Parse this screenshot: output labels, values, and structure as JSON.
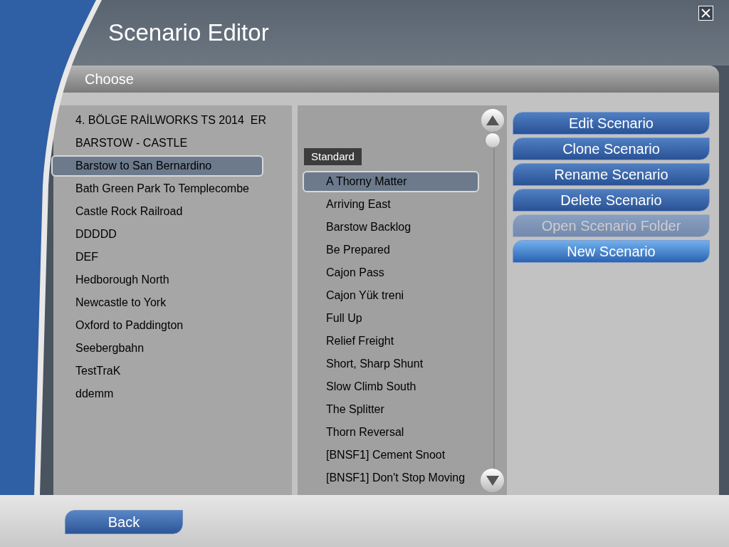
{
  "window": {
    "title": "Scenario Editor"
  },
  "section": {
    "title": "Choose"
  },
  "routes": [
    {
      "label": "4. BÖLGE RAİLWORKS TS 2014  ER",
      "selected": false
    },
    {
      "label": "BARSTOW - CASTLE",
      "selected": false
    },
    {
      "label": "Barstow to San Bernardino",
      "selected": true
    },
    {
      "label": "Bath Green Park To Templecombe",
      "selected": false
    },
    {
      "label": "Castle Rock Railroad",
      "selected": false
    },
    {
      "label": "DDDDD",
      "selected": false
    },
    {
      "label": "DEF",
      "selected": false
    },
    {
      "label": "Hedborough North",
      "selected": false
    },
    {
      "label": "Newcastle to York",
      "selected": false
    },
    {
      "label": "Oxford to Paddington",
      "selected": false
    },
    {
      "label": "Seebergbahn",
      "selected": false
    },
    {
      "label": "TestTraK",
      "selected": false
    },
    {
      "label": "ddemm",
      "selected": false
    }
  ],
  "scenarios": {
    "group": "Standard",
    "items": [
      {
        "label": "A Thorny Matter",
        "selected": true
      },
      {
        "label": "Arriving East",
        "selected": false
      },
      {
        "label": "Barstow Backlog",
        "selected": false
      },
      {
        "label": "Be Prepared",
        "selected": false
      },
      {
        "label": "Cajon Pass",
        "selected": false
      },
      {
        "label": "Cajon Yük treni",
        "selected": false
      },
      {
        "label": "Full Up",
        "selected": false
      },
      {
        "label": "Relief Freight",
        "selected": false
      },
      {
        "label": "Short, Sharp Shunt",
        "selected": false
      },
      {
        "label": "Slow Climb South",
        "selected": false
      },
      {
        "label": "The Splitter",
        "selected": false
      },
      {
        "label": "Thorn Reversal",
        "selected": false
      },
      {
        "label": "[BNSF1] Cement Snoot",
        "selected": false
      },
      {
        "label": "[BNSF1] Don't Stop Moving",
        "selected": false
      }
    ]
  },
  "actions": [
    {
      "label": "Edit Scenario",
      "disabled": false,
      "highlighted": false
    },
    {
      "label": "Clone Scenario",
      "disabled": false,
      "highlighted": false
    },
    {
      "label": "Rename Scenario",
      "disabled": false,
      "highlighted": false
    },
    {
      "label": "Delete Scenario",
      "disabled": false,
      "highlighted": false
    },
    {
      "label": "Open Scenario Folder",
      "disabled": true,
      "highlighted": false
    },
    {
      "label": "New Scenario",
      "disabled": false,
      "highlighted": true
    }
  ],
  "back_button": {
    "label": "Back"
  }
}
